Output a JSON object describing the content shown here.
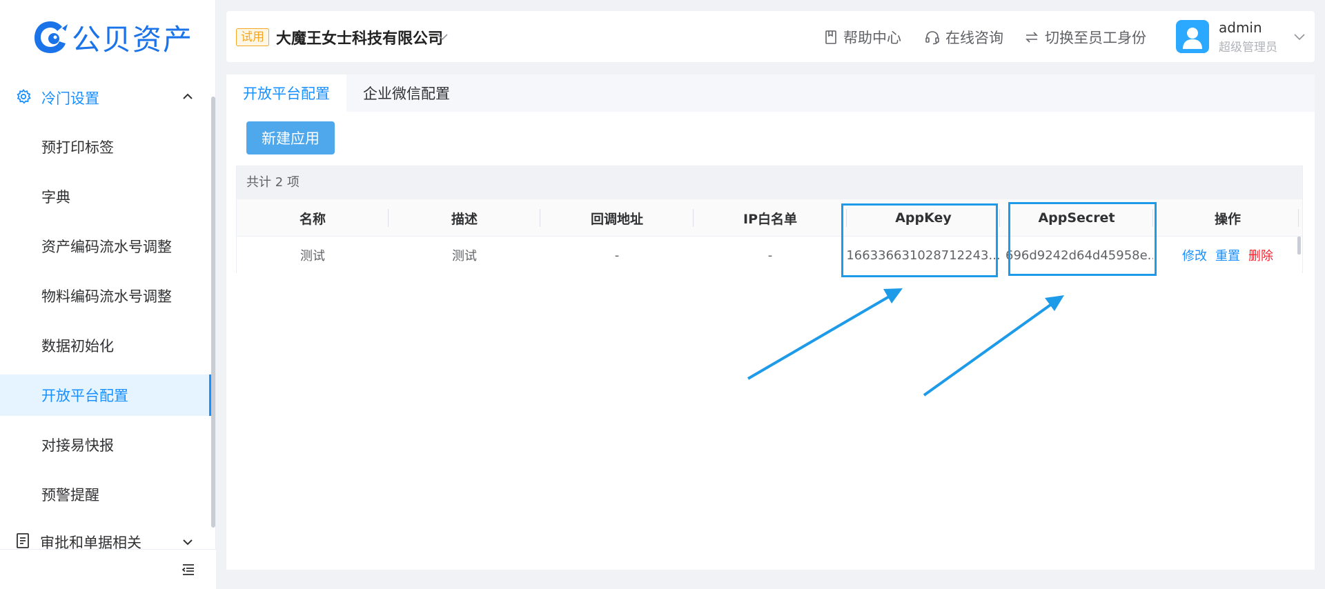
{
  "brand": {
    "name": "公贝资产",
    "color": "#1a73e8"
  },
  "sidebar": {
    "group_label": "冷门设置",
    "items": [
      {
        "label": "预打印标签"
      },
      {
        "label": "字典"
      },
      {
        "label": "资产编码流水号调整"
      },
      {
        "label": "物料编码流水号调整"
      },
      {
        "label": "数据初始化"
      },
      {
        "label": "开放平台配置",
        "active": true
      },
      {
        "label": "对接易快报"
      },
      {
        "label": "预警提醒"
      }
    ],
    "group2_label": "审批和单据相关"
  },
  "header": {
    "trial_badge": "试用",
    "company": "大魔王女士科技有限公司",
    "help": "帮助中心",
    "consult": "在线咨询",
    "switch": "切换至员工身份",
    "user_name": "admin",
    "user_role": "超级管理员"
  },
  "tabs": [
    {
      "label": "开放平台配置",
      "active": true
    },
    {
      "label": "企业微信配置"
    }
  ],
  "new_button": "新建应用",
  "table": {
    "total": "共计 2 项",
    "columns": [
      "名称",
      "描述",
      "回调地址",
      "IP白名单",
      "AppKey",
      "AppSecret",
      "操作"
    ],
    "rows": [
      {
        "name": "测试",
        "desc": "测试",
        "callback": "-",
        "ip": "-",
        "appkey": "166336631028712243...",
        "appsecret": "696d9242d64d45958e...",
        "actions": [
          "修改",
          "重置",
          "删除"
        ]
      }
    ]
  },
  "accent_color": "#1890ff",
  "annotation_color": "#1e9be8"
}
